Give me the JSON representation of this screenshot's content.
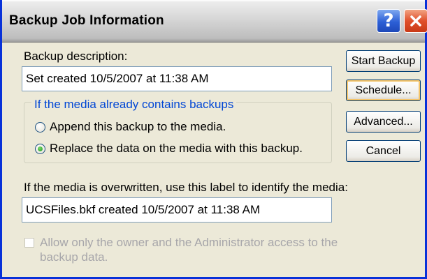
{
  "window": {
    "title": "Backup Job Information",
    "help_glyph": "?",
    "icons": {
      "help": "help-icon",
      "close": "close-icon"
    }
  },
  "form": {
    "description_label": "Backup description:",
    "description_value": "Set created 10/5/2007 at 11:38 AM",
    "group_title": "If the media already contains backups",
    "radio_append_label": "Append this backup to the media.",
    "radio_replace_label": "Replace the data on the media with this backup.",
    "radio_selected": "replace",
    "media_label_caption": "If the media is overwritten, use this label to identify the media:",
    "media_label_value": "UCSFiles.bkf created 10/5/2007 at 11:38 AM",
    "restrict_access_label": "Allow only the owner and the Administrator access to the backup data.",
    "restrict_access_checked": false,
    "restrict_access_enabled": false
  },
  "buttons": {
    "start_backup": "Start Backup",
    "schedule": "Schedule...",
    "advanced": "Advanced...",
    "cancel": "Cancel"
  },
  "colors": {
    "window_border": "#0831d9",
    "dialog_bg": "#ece9d8",
    "group_title": "#0046d5",
    "disabled_text": "#a7a6aa"
  }
}
